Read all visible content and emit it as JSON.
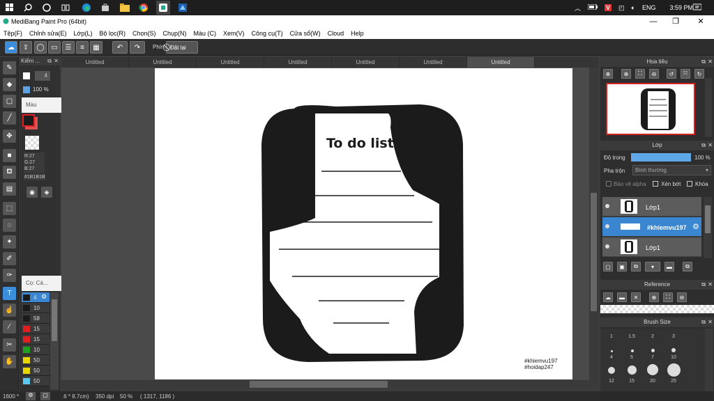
{
  "taskbar": {
    "lang": "ENG",
    "time": "3:59 PM"
  },
  "window": {
    "title": "MediBang Paint Pro (64bit)"
  },
  "menu": [
    "Tệp(F)",
    "Chỉnh sửa(E)",
    "Lớp(L)",
    "Bộ lọc(R)",
    "Chọn(S)",
    "Chụp(N)",
    "Màu (C)",
    "Xem(V)",
    "Công cụ(T)",
    "Cửa sổ(W)",
    "Cloud",
    "Help"
  ],
  "toolbar": {
    "snap_label": "Phím",
    "reset_label": "Đặt lại"
  },
  "tabs": [
    "Untitled",
    "Untitled",
    "Untitled",
    "Untitled",
    "Untitled",
    "Untitled",
    "Untitled"
  ],
  "brush_panel": {
    "title": "Kiểm ...",
    "size": "4",
    "opacity": "100 %"
  },
  "color_panel": {
    "title": "Màu",
    "r": "R:27",
    "g": "G:27",
    "b": "B:27",
    "hex": "#1B1B1B",
    "fg": "#1b1b1b",
    "bg": "#e05050"
  },
  "brush_list": {
    "title": "Cọ: Cá...",
    "items": [
      {
        "size": "4",
        "color": "#1b1b1b"
      },
      {
        "size": "10",
        "color": "#1b1b1b"
      },
      {
        "size": "58",
        "color": "#1b1b1b"
      },
      {
        "size": "15",
        "color": "#e02020"
      },
      {
        "size": "15",
        "color": "#e02020"
      },
      {
        "size": "10",
        "color": "#20a020"
      },
      {
        "size": "50",
        "color": "#e8d800"
      },
      {
        "size": "50",
        "color": "#e8d800"
      },
      {
        "size": "50",
        "color": "#60c8f0"
      }
    ]
  },
  "canvas": {
    "title": "To do list",
    "watermark1": "#khiemvu197",
    "watermark2": "#hoidap247"
  },
  "navigator": {
    "title": "Hoa tiêu"
  },
  "layer_panel": {
    "title": "Lớp",
    "opacity_label": "Độ trong",
    "opacity_value": "100 %",
    "blend_label": "Pha trộn",
    "blend_value": "Bình thường",
    "protect_alpha": "Bảo vệ alpha",
    "clip": "Xén bớt",
    "lock": "Khóa",
    "layers": [
      {
        "name": "Lớp1"
      },
      {
        "name": "#khiemvu197"
      },
      {
        "name": "Lớp1"
      }
    ]
  },
  "reference_panel": {
    "title": "Reference"
  },
  "brush_size_panel": {
    "title": "Brush Size",
    "sizes": [
      "1",
      "1.5",
      "2",
      "3",
      "4",
      "5",
      "7",
      "10",
      "12",
      "15",
      "20",
      "25"
    ]
  },
  "status": {
    "zoom_left": "1600 *",
    "dims": ".6 * 8.7cm)",
    "dpi": "350 dpi",
    "zoom": "50 %",
    "coords": "( 1317, 1186 )"
  }
}
